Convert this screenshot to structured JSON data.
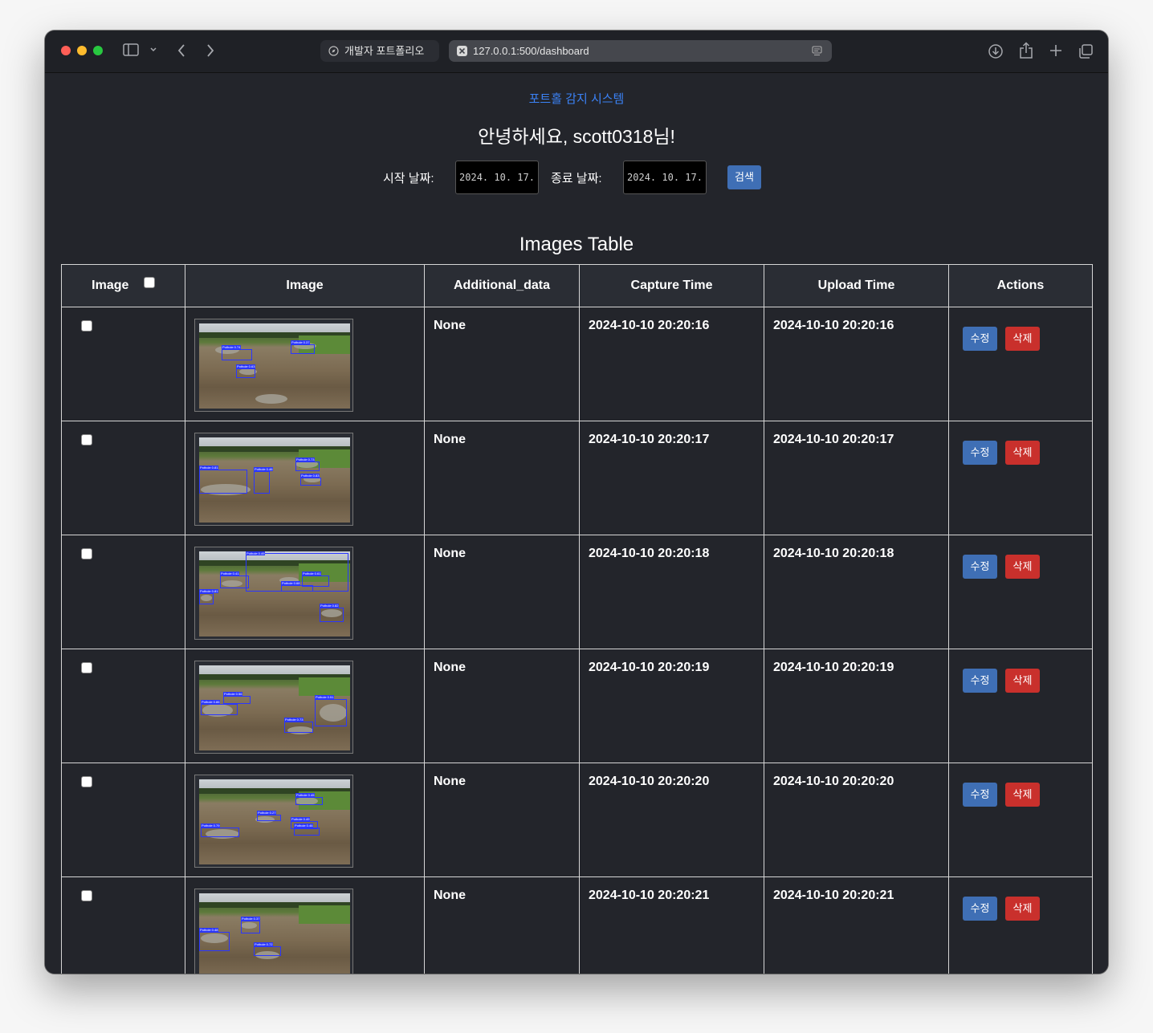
{
  "browser": {
    "inactive_tab": "개발자 포트폴리오",
    "url": "127.0.0.1:500/dashboard"
  },
  "header": {
    "app_title": "포트홀 감지 시스템",
    "greeting": "안녕하세요, scott0318님!"
  },
  "filter": {
    "start_label": "시작 날짜:",
    "start_value": "2024. 10. 17.",
    "end_label": "종료 날짜:",
    "end_value": "2024. 10. 17.",
    "search_label": "검색"
  },
  "table": {
    "title": "Images Table",
    "columns": [
      "Image",
      "Image",
      "Additional_data",
      "Capture Time",
      "Upload Time",
      "Actions"
    ],
    "edit_label": "수정",
    "delete_label": "삭제",
    "rows": [
      {
        "additional": "None",
        "capture": "2024-10-10 20:20:16",
        "upload": "2024-10-10 20:20:16"
      },
      {
        "additional": "None",
        "capture": "2024-10-10 20:20:17",
        "upload": "2024-10-10 20:20:17"
      },
      {
        "additional": "None",
        "capture": "2024-10-10 20:20:18",
        "upload": "2024-10-10 20:20:18"
      },
      {
        "additional": "None",
        "capture": "2024-10-10 20:20:19",
        "upload": "2024-10-10 20:20:19"
      },
      {
        "additional": "None",
        "capture": "2024-10-10 20:20:20",
        "upload": "2024-10-10 20:20:20"
      },
      {
        "additional": "None",
        "capture": "2024-10-10 20:20:21",
        "upload": "2024-10-10 20:20:21"
      }
    ]
  },
  "detections": [
    [
      "Pothole 0.74",
      "Pothole 0.37",
      "Pothole 0.63"
    ],
    [
      "Pothole 0.81",
      "Pothole 0.46",
      "Pothole 0.73",
      "Pothole 0.83"
    ],
    [
      "Pothole 0.41",
      "Pothole 0.49",
      "Pothole 0.61",
      "Pothole 0.68",
      "Pothole 0.81",
      "Pothole 0.82"
    ],
    [
      "Pothole 0.56",
      "Pothole 0.51",
      "Pothole 0.86",
      "Pothole 0.73"
    ],
    [
      "Pothole 0.45",
      "Pothole 0.27",
      "Pothole 0.49",
      "Pothole 0.79",
      "Pothole 0.46"
    ],
    [
      "Pothole 0.37",
      "Pothole 0.48",
      "Pothole 0.72"
    ]
  ],
  "icons": [
    "sidebar-icon",
    "chevron-down-icon",
    "back-arrow-icon",
    "forward-arrow-icon",
    "compass-icon",
    "page-close-icon",
    "reader-icon",
    "download-icon",
    "share-icon",
    "new-tab-icon",
    "tab-overview-icon"
  ]
}
